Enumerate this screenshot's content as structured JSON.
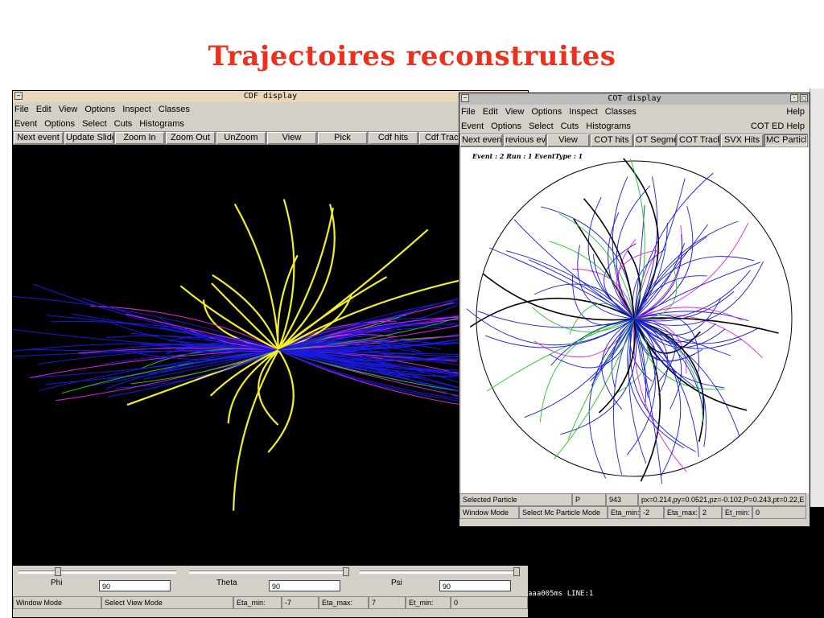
{
  "slide": {
    "title": "Trajectoires reconstruites"
  },
  "cdf": {
    "title": "CDF display",
    "menu1": [
      "File",
      "Edit",
      "View",
      "Options",
      "Inspect",
      "Classes"
    ],
    "menu2": [
      "Event",
      "Options",
      "Select",
      "Cuts",
      "Histograms"
    ],
    "toolbar": [
      "Next event",
      "Update Slider",
      "Zoom In",
      "Zoom Out",
      "UnZoom",
      "View",
      "Pick",
      "Cdf hits",
      "Cdf Track"
    ],
    "sliders": {
      "phi_label": "Phi",
      "phi_value": "90",
      "theta_label": "Theta",
      "theta_value": "90",
      "psi_label": "Psi",
      "psi_value": "90"
    },
    "status": [
      "Window Mode",
      "Select View Mode",
      "Eta_min:",
      "-7",
      "Eta_max:",
      "7",
      "Et_min:",
      "0"
    ]
  },
  "cot": {
    "title": "COT display",
    "menu1": [
      "File",
      "Edit",
      "View",
      "Options",
      "Inspect",
      "Classes"
    ],
    "menu1_right": "Help",
    "menu2": [
      "Event",
      "Options",
      "Select",
      "Cuts",
      "Histograms"
    ],
    "menu2_right": "COT ED Help",
    "toolbar": [
      "Next event",
      "revious eve",
      "View",
      "COT hits",
      "OT Segmen",
      "COT Tracks",
      "SVX Hits",
      "MC Particle"
    ],
    "event_label": "Event : 2 Run : 1 EventType : 1",
    "status1": [
      "Selected Particle",
      "P",
      "943",
      "px=0.214,py=0.0521,pz=-0.102,P=0.243,pt=0.22,E"
    ],
    "status2": [
      "Window Mode",
      "Select Mc Particle Mode",
      "Eta_min:",
      "-2",
      "Eta_max:",
      "2",
      "Et_min:",
      "0"
    ]
  },
  "terminal": {
    "text": "aaa005ms LINE:1"
  },
  "colors": {
    "title": "#e8321e",
    "window_bg": "#d4d0c8",
    "track_blue": "#1a1adc",
    "track_yellow": "#f2ee2a",
    "track_magenta": "#e020e0",
    "track_green": "#1ec81e"
  }
}
